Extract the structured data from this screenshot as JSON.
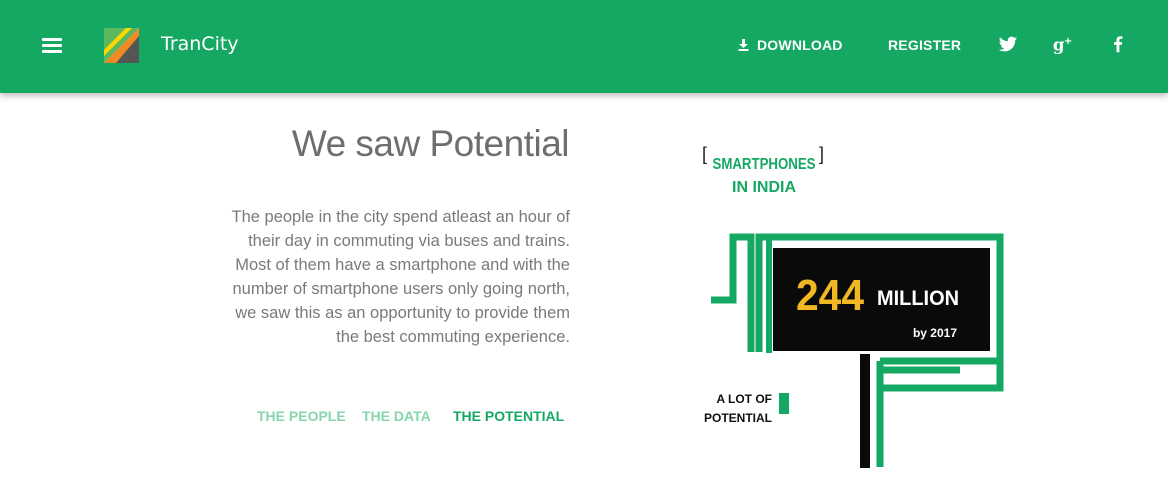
{
  "header": {
    "brand": "TranCity",
    "nav": {
      "download": "DOWNLOAD",
      "register": "REGISTER"
    },
    "social": [
      "twitter-icon",
      "google-plus-icon",
      "facebook-icon"
    ],
    "menu_icon": "hamburger-menu-icon",
    "colors": {
      "bar": "#15a863",
      "text": "#ffffff"
    }
  },
  "main": {
    "title": "We saw Potential",
    "paragraph_lines": [
      "The people in the city spend atleast an hour of",
      "their day in commuting via buses and trains.",
      "Most of them have a smartphone and with the",
      "number of smartphone users only going north,",
      "we saw this as an opportunity to provide them",
      "the best commuting experience."
    ],
    "tabs": [
      {
        "label": "THE PEOPLE",
        "active": false
      },
      {
        "label": "THE DATA",
        "active": false
      },
      {
        "label": "THE POTENTIAL",
        "active": true
      }
    ]
  },
  "infographic": {
    "bracket_left": "[",
    "bracket_right": "]",
    "heading_line1": "SMARTPHONES",
    "heading_line2": "IN INDIA",
    "number": "244",
    "unit": "MILLION",
    "by_year": "by 2017",
    "caption_line1": "A LOT OF",
    "caption_line2": "POTENTIAL",
    "colors": {
      "green": "#15a863",
      "accent": "#f2b824",
      "dark": "#0a0a0a"
    }
  }
}
